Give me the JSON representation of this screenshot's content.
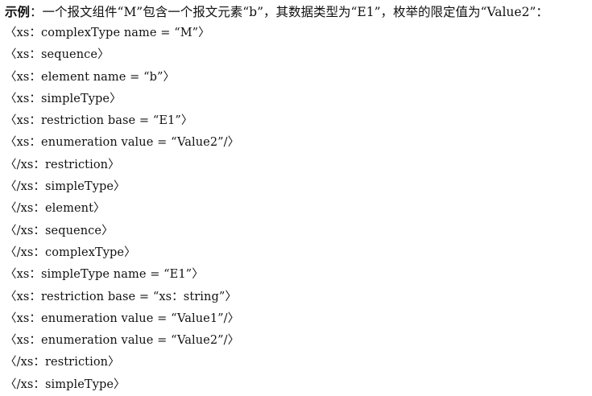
{
  "document": {
    "title_lead": "示例",
    "title_text": "：一个报文组件“M”包含一个报文元素“b”，其数据类型为“E1”，枚举的限定值为“Value2”：",
    "lines": [
      "〈xs：complexType name = “M”〉",
      "〈xs：sequence〉",
      "〈xs：element name = “b”〉",
      "〈xs：simpleType〉",
      "〈xs：restriction base = “E1”〉",
      "〈xs：enumeration value = “Value2”/〉",
      "〈/xs：restriction〉",
      "〈/xs：simpleType〉",
      "〈/xs：element〉",
      "〈/xs：sequence〉",
      "〈/xs：complexType〉",
      "〈xs：simpleType name = “E1”〉",
      "〈xs：restriction base = “xs：string”〉",
      "〈xs：enumeration value = “Value1”/〉",
      "〈xs：enumeration value = “Value2”/〉",
      "〈/xs：restriction〉",
      "〈/xs：simpleType〉"
    ]
  }
}
